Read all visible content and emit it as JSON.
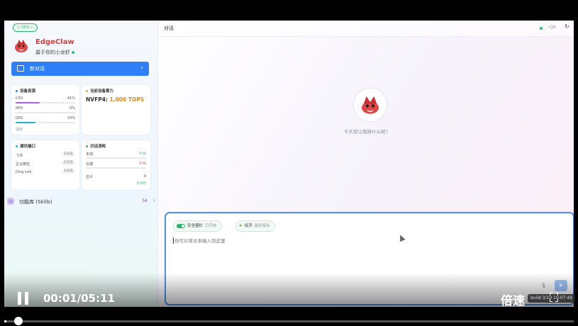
{
  "status": {
    "battery": "55%"
  },
  "brand": {
    "name": "EdgeClaw",
    "subtitle": "属于你的小龙虾"
  },
  "sidebar": {
    "new_chat_label": "新对话",
    "device_resources": {
      "title": "设备资源",
      "rows": [
        {
          "label": "CPU",
          "value": "41%",
          "percent": 41,
          "color": "#a660e6"
        },
        {
          "label": "NPU",
          "value": "0%",
          "percent": 0,
          "color": "#2f80f6"
        },
        {
          "label": "GPU",
          "value": "33%",
          "percent": 33,
          "color": "#22b3d6"
        }
      ],
      "footer": "温度"
    },
    "compute": {
      "title": "当前设备算力",
      "label": "NVFP4:",
      "value": "1,000 TOPS"
    },
    "channels": {
      "title": "通讯端口",
      "items": [
        {
          "label": "飞书",
          "status": "未配置"
        },
        {
          "label": "企业微信",
          "status": "未配置"
        },
        {
          "label": "Ding talk",
          "status": "未配置"
        }
      ]
    },
    "usage": {
      "title": "对话消耗",
      "rows": [
        {
          "label": "本地",
          "value": "0 tk",
          "color": "#24b56c"
        },
        {
          "label": "云端",
          "value": "0 tk",
          "color": "#e03b3b"
        }
      ],
      "total_label": "总计",
      "total_value": "0",
      "total_cost": "0.0元"
    },
    "skills": {
      "label": "功能库 (Skills)",
      "count": "54"
    }
  },
  "main": {
    "title": "对话",
    "prompt": "今天想让我做什么呢?",
    "composer": {
      "chip_security_label": "安全围栏",
      "chip_security_status": "已开启",
      "chip_eco_label": "经济",
      "chip_eco_status": "最优组合",
      "placeholder": "你可以将文本输入到这里"
    }
  },
  "video": {
    "time": "00:01/05:11",
    "speed_label": "倍速",
    "build": "build 3/10 10:07:49",
    "progress": 0.0032
  },
  "colors": {
    "accent": "#2f80f6",
    "brand": "#e03b3b",
    "success": "#24b56c"
  }
}
